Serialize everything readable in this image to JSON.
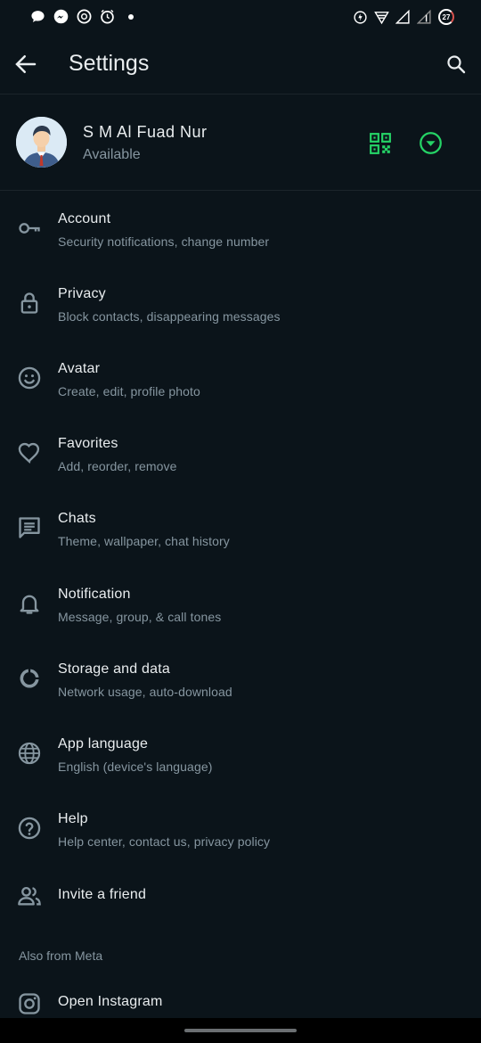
{
  "status_bar": {
    "left_icons": [
      "chat-bubble-icon",
      "messenger-icon",
      "chatgpt-icon",
      "alarm-app-icon",
      "notification-dot"
    ],
    "right_icons": [
      "data-saver-icon",
      "wifi-icon",
      "signal-icon",
      "signal-empty-icon",
      "battery-icon"
    ],
    "battery_level": "27"
  },
  "header": {
    "title": "Settings"
  },
  "profile": {
    "name": "S M Al Fuad Nur",
    "status": "Available"
  },
  "accent_color": "#25d366",
  "menu": [
    {
      "title": "Account",
      "subtitle": "Security notifications, change number",
      "icon": "key-icon"
    },
    {
      "title": "Privacy",
      "subtitle": "Block contacts, disappearing messages",
      "icon": "lock-icon"
    },
    {
      "title": "Avatar",
      "subtitle": "Create, edit, profile photo",
      "icon": "smiley-icon"
    },
    {
      "title": "Favorites",
      "subtitle": "Add, reorder, remove",
      "icon": "heart-icon"
    },
    {
      "title": "Chats",
      "subtitle": "Theme, wallpaper, chat history",
      "icon": "chat-icon"
    },
    {
      "title": "Notification",
      "subtitle": "Message, group, & call tones",
      "icon": "bell-icon"
    },
    {
      "title": "Storage and data",
      "subtitle": "Network usage, auto-download",
      "icon": "storage-icon"
    },
    {
      "title": "App language",
      "subtitle": "English (device's language)",
      "icon": "globe-icon"
    },
    {
      "title": "Help",
      "subtitle": "Help center, contact us, privacy policy",
      "icon": "help-icon"
    },
    {
      "title": "Invite a friend",
      "icon": "people-icon"
    }
  ],
  "meta_section": {
    "label": "Also from Meta",
    "items": [
      {
        "title": "Open Instagram",
        "icon": "instagram-icon"
      }
    ]
  }
}
